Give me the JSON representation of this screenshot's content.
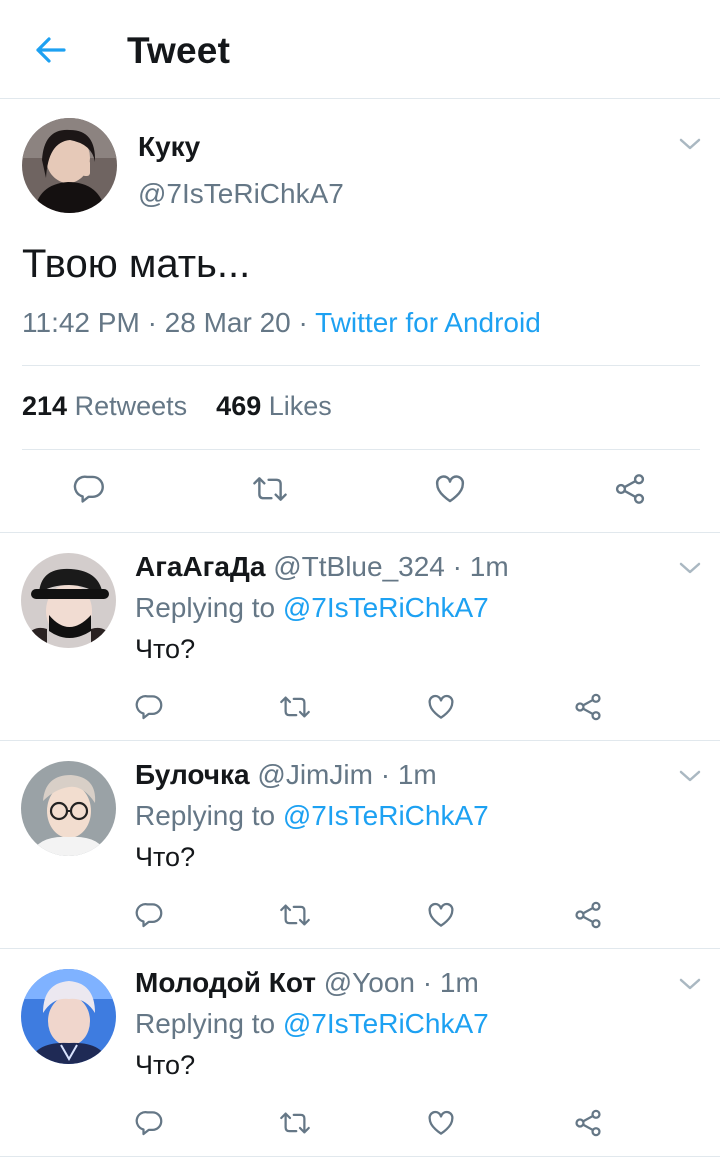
{
  "header": {
    "title": "Tweet",
    "back_icon": "arrow-left-icon",
    "accent": "#1da1f2"
  },
  "tweet": {
    "name": "Куку",
    "handle": "@7IsTeRiChkA7",
    "text": "Твою мать...",
    "time": "11:42 PM",
    "date": "28 Mar 20",
    "source": "Twitter for Android",
    "retweets_count": "214",
    "retweets_label": "Retweets",
    "likes_count": "469",
    "likes_label": "Likes"
  },
  "actions": [
    "reply-icon",
    "retweet-icon",
    "like-icon",
    "share-icon"
  ],
  "replies": [
    {
      "name": "АгаАгаДа",
      "handle": "@TtBlue_324",
      "time": "1m",
      "replying_label": "Replying to",
      "replying_to": "@7IsTeRiChkA7",
      "text": "Что?"
    },
    {
      "name": "Булочка",
      "handle": "@JimJim",
      "time": "1m",
      "replying_label": "Replying to",
      "replying_to": "@7IsTeRiChkA7",
      "text": "Что?"
    },
    {
      "name": "Молодой Кот",
      "handle": "@Yoon",
      "time": "1m",
      "replying_label": "Replying to",
      "replying_to": "@7IsTeRiChkA7",
      "text": "Что?"
    }
  ]
}
